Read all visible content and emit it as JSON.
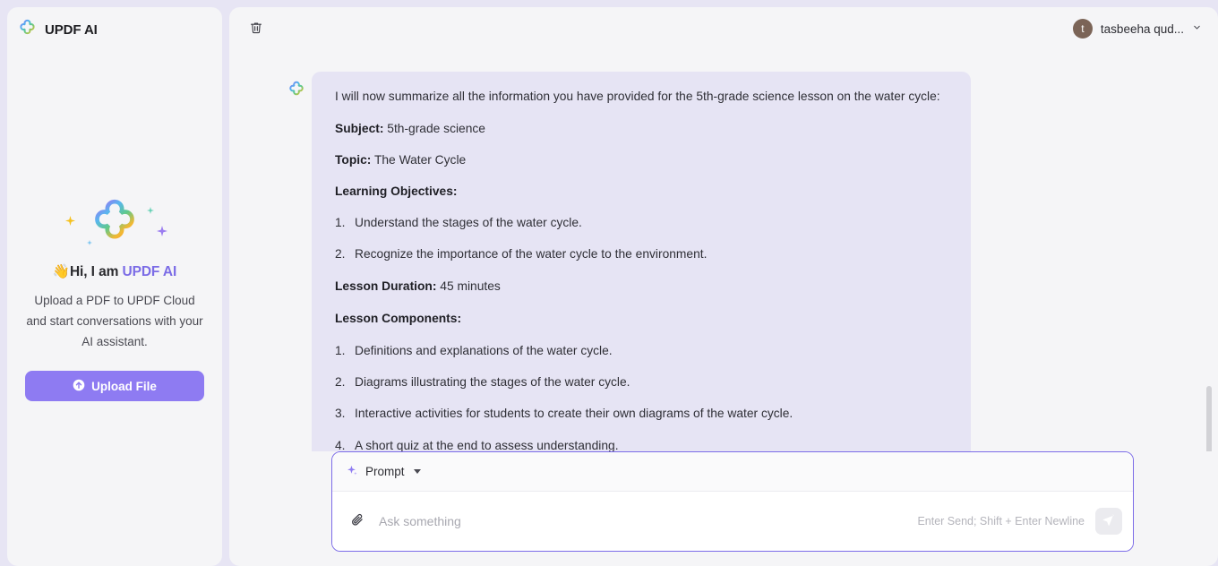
{
  "sidebar": {
    "brand_title": "UPDF AI",
    "brand_icon": "updf-clover-logo-icon",
    "hero_icon": "updf-clover-logo-large-icon",
    "greeting_wave": "👋",
    "greeting_prefix": "Hi, I am ",
    "greeting_accent": "UPDF AI",
    "description": "Upload a PDF to UPDF Cloud and start conversations with your AI assistant.",
    "upload_label": "Upload File",
    "upload_icon": "upload-circle-arrow-icon",
    "upload_color": "#8e7bf2"
  },
  "topbar": {
    "delete_icon": "trash-icon",
    "user_name": "tasbeeha qud...",
    "avatar_initial": "t",
    "avatar_color": "#7b6457",
    "chevron_icon": "chevron-down-icon"
  },
  "message": {
    "avatar_icon": "updf-clover-logo-icon",
    "intro": "I will now summarize all the information you have provided for the 5th-grade science lesson on the water cycle:",
    "subject_label": "Subject:",
    "subject_value": " 5th-grade science",
    "topic_label": "Topic:",
    "topic_value": " The Water Cycle",
    "objectives_label": "Learning Objectives:",
    "objectives": [
      {
        "num": "1.",
        "text": "Understand the stages of the water cycle."
      },
      {
        "num": "2.",
        "text": "Recognize the importance of the water cycle to the environment."
      }
    ],
    "duration_label": "Lesson Duration:",
    "duration_value": " 45 minutes",
    "components_label": "Lesson Components:",
    "components": [
      {
        "num": "1.",
        "text": "Definitions and explanations of the water cycle."
      },
      {
        "num": "2.",
        "text": "Diagrams illustrating the stages of the water cycle."
      },
      {
        "num": "3.",
        "text": "Interactive activities for students to create their own diagrams of the water cycle."
      },
      {
        "num": "4.",
        "text": "A short quiz at the end to assess understanding."
      }
    ],
    "bubble_color": "#e6e4f4"
  },
  "composer": {
    "prompt_label": "Prompt",
    "prompt_icon": "sparkle-icon",
    "caret_icon": "chevron-down-icon",
    "attach_icon": "paperclip-icon",
    "input_value": "",
    "input_placeholder": "Ask something",
    "hint": "Enter Send; Shift + Enter Newline",
    "send_icon": "send-paper-plane-icon",
    "border_color": "#7c6ce8"
  }
}
